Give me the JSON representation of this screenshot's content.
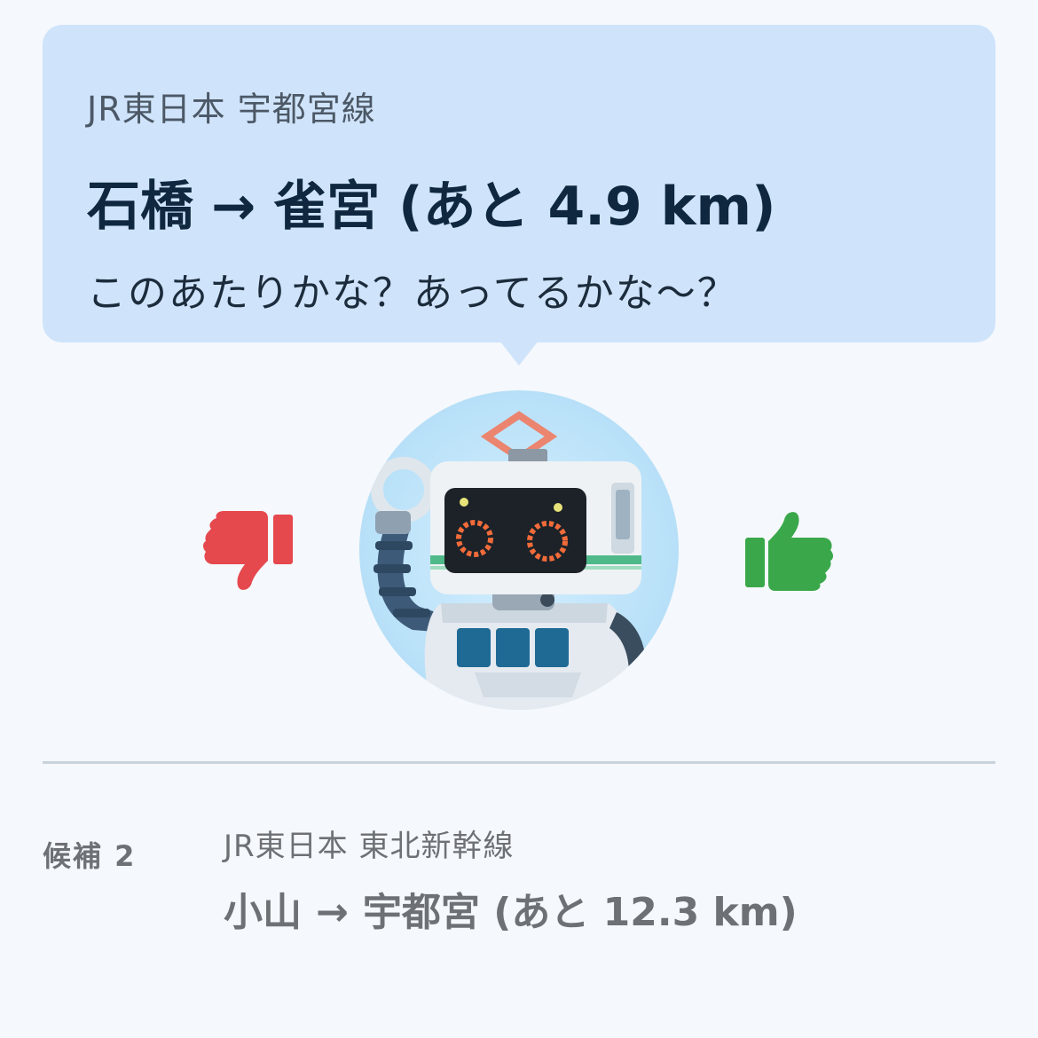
{
  "current": {
    "line_name": "JR東日本 宇都宮線",
    "from_station": "石橋",
    "arrow": "→",
    "to_station": "雀宮",
    "remaining": "(あと 4.9 km)",
    "message": "このあたりかな？あってるかな〜？"
  },
  "feedback": {
    "thumbs_down_icon": "thumbs-down-icon",
    "thumbs_up_icon": "thumbs-up-icon",
    "thumbs_down_color": "#e5484d",
    "thumbs_up_color": "#3aa84a"
  },
  "candidate": {
    "label": "候補 2",
    "line_name": "JR東日本 東北新幹線",
    "from_station": "小山",
    "arrow": "→",
    "to_station": "宇都宮",
    "remaining": "(あと 12.3 km)"
  },
  "colors": {
    "bubble": "#cfe4fb",
    "background": "#f5f8fc",
    "title_text": "#0f2840",
    "muted_text": "#6d7176"
  }
}
